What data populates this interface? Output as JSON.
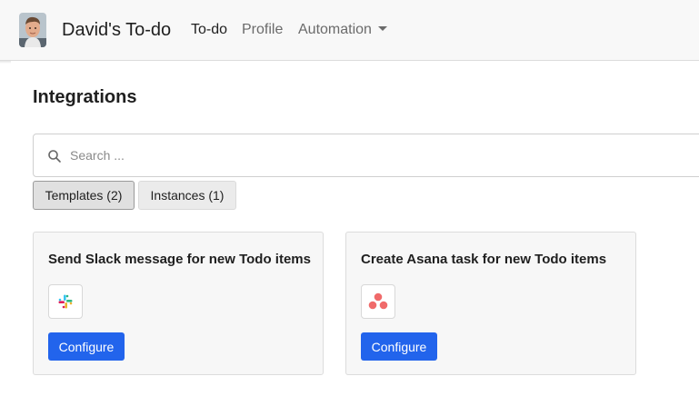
{
  "header": {
    "brand": "David's To-do",
    "nav": [
      {
        "label": "To-do",
        "active": true
      },
      {
        "label": "Profile",
        "active": false
      },
      {
        "label": "Automation",
        "active": false,
        "dropdown": true
      }
    ]
  },
  "page": {
    "title": "Integrations"
  },
  "search": {
    "placeholder": "Search ...",
    "value": "",
    "icon": "search-icon"
  },
  "tabs": [
    {
      "label": "Templates (2)",
      "selected": true
    },
    {
      "label": "Instances (1)",
      "selected": false
    }
  ],
  "cards": [
    {
      "title": "Send Slack message for new Todo items",
      "icon": "slack-logo-icon",
      "button": "Configure"
    },
    {
      "title": "Create Asana task for new Todo items",
      "icon": "asana-logo-icon",
      "button": "Configure"
    }
  ],
  "colors": {
    "primary": "#2264ec",
    "navbar_bg": "#f8f8f8",
    "card_bg": "#f7f7f7",
    "asana": "#f06a6a",
    "slack": [
      "#e01e5a",
      "#36c5f0",
      "#2eb67d",
      "#ecb22e"
    ]
  }
}
